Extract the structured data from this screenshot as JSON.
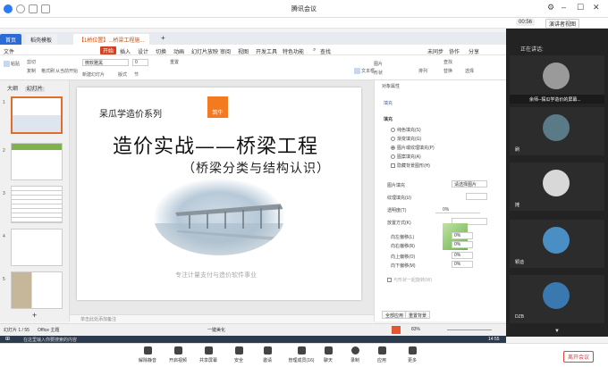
{
  "window": {
    "title": "腾讯会议"
  },
  "meeting": {
    "timer": "00:56",
    "view_mode": "演讲者视图"
  },
  "wps": {
    "tabs": [
      {
        "label": "首页"
      },
      {
        "label": "稻壳模板"
      },
      {
        "label": "【1桥位置】...桥梁工程施..."
      }
    ],
    "menu": [
      "文件",
      "开始",
      "插入",
      "设计",
      "切换",
      "动画",
      "幻灯片放映",
      "审阅",
      "视图",
      "开发工具",
      "特色功能"
    ],
    "menu_active": "开始",
    "search": "查找",
    "ribbon": {
      "paste": "粘贴",
      "cut": "剪切",
      "copy": "复制",
      "format_painter": "格式刷",
      "from_current": "从当前开始",
      "new_slide": "新建幻灯片",
      "layout": "版式",
      "reset": "重置",
      "section": "节",
      "font": "微软雅黑",
      "font_size": "0",
      "picture": "图片",
      "shape": "形状",
      "textbox": "文本框",
      "arrange": "排列",
      "find": "查找",
      "replace": "替换",
      "select": "选择",
      "not_synced": "未同步",
      "collaborate": "协作",
      "share": "分享"
    },
    "left_tabs": [
      "大纲",
      "幻灯片"
    ],
    "slide_numbers": [
      "1",
      "2",
      "3",
      "4",
      "5"
    ],
    "notes_hint": "单击此处添加备注",
    "status_left": "幻灯片 1 / 55",
    "status_theme": "Office 主题",
    "zoom": "83%",
    "beautify": "一键美化"
  },
  "slide": {
    "series": "呆瓜学造价系列",
    "logo_text": "筑牛",
    "main_title": "造价实战——桥梁工程",
    "subtitle": "（桥梁分类与结构认识）",
    "footer": "专注计量支付与造价软件事业"
  },
  "props": {
    "title": "对象属性",
    "tab": "填充",
    "section": "填充",
    "fill_options": [
      "纯色填充(S)",
      "渐变填充(G)",
      "图片或纹理填充(P)",
      "图案填充(A)"
    ],
    "fill_selected": 2,
    "hide_bg": "隐藏背景图形(H)",
    "picture_fill": "图片填充",
    "picture_fill_value": "请选择图片",
    "texture_fill": "纹理填充(U)",
    "transparency": "透明度(T)",
    "transparency_value": "0%",
    "tile": "放置方式(K)",
    "offset_left": "向左偏移(L)",
    "offset_right": "向右偏移(R)",
    "offset_top": "向上偏移(O)",
    "offset_bottom": "向下偏移(M)",
    "offset_values": [
      "0%",
      "0%",
      "0%",
      "0%"
    ],
    "rotate_with": "与形状一起旋转(W)",
    "apply_all": "全部应用",
    "reset_bg": "重置背景"
  },
  "participants": {
    "speaking_label": "正在讲话:",
    "presenter_banner": "余师--探瓜学造价的屏幕...",
    "people": [
      {
        "name": ""
      },
      {
        "name": "刷"
      },
      {
        "name": "摊"
      },
      {
        "name": "颖迪"
      },
      {
        "name": "DZB"
      }
    ]
  },
  "windows_search": "在这里输入你要搜索的内容",
  "system_clock": "14:55",
  "toolbar": {
    "items": [
      "解除静音",
      "开启视频",
      "共享屏幕",
      "安全",
      "邀请",
      "管理成员(16)",
      "聊天",
      "录制",
      "应用",
      "更多"
    ],
    "end": "离开会议"
  }
}
